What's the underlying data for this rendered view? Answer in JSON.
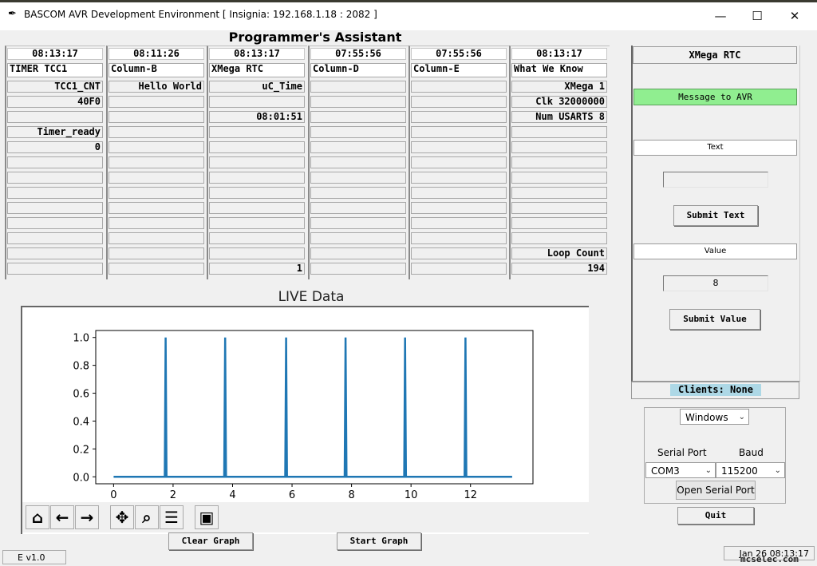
{
  "window": {
    "title": "BASCOM AVR Development Environment  [ Insignia: 192.168.1.18 : 2082 ]",
    "minimize": "—",
    "maximize": "☐",
    "close": "✕"
  },
  "assistant_title": "Programmer's Assistant",
  "columns": [
    {
      "time": "08:13:17",
      "header": "TIMER TCC1",
      "cells": [
        [
          "TCC1_CNT",
          "r"
        ],
        [
          "40F0",
          "r"
        ],
        [
          "",
          ""
        ],
        [
          "Timer_ready",
          "r"
        ],
        [
          "0",
          "r"
        ],
        [
          "",
          ""
        ],
        [
          "",
          ""
        ],
        [
          "",
          ""
        ],
        [
          "",
          ""
        ],
        [
          "",
          ""
        ],
        [
          "",
          ""
        ],
        [
          "",
          ""
        ],
        [
          "",
          ""
        ]
      ]
    },
    {
      "time": "08:11:26",
      "header": "Column-B",
      "cells": [
        [
          "Hello World",
          "r"
        ],
        [
          "",
          ""
        ],
        [
          "",
          ""
        ],
        [
          "",
          ""
        ],
        [
          "",
          ""
        ],
        [
          "",
          ""
        ],
        [
          "",
          ""
        ],
        [
          "",
          ""
        ],
        [
          "",
          ""
        ],
        [
          "",
          ""
        ],
        [
          "",
          ""
        ],
        [
          "",
          ""
        ],
        [
          "",
          ""
        ]
      ]
    },
    {
      "time": "08:13:17",
      "header": "XMega RTC",
      "cells": [
        [
          "uC_Time",
          "r"
        ],
        [
          "",
          ""
        ],
        [
          "08:01:51",
          "r"
        ],
        [
          "",
          ""
        ],
        [
          "",
          ""
        ],
        [
          "",
          ""
        ],
        [
          "",
          ""
        ],
        [
          "",
          ""
        ],
        [
          "",
          ""
        ],
        [
          "",
          ""
        ],
        [
          "",
          ""
        ],
        [
          "",
          ""
        ],
        [
          "1",
          "r"
        ]
      ]
    },
    {
      "time": "07:55:56",
      "header": "Column-D",
      "cells": [
        [
          "",
          ""
        ],
        [
          "",
          ""
        ],
        [
          "",
          ""
        ],
        [
          "",
          ""
        ],
        [
          "",
          ""
        ],
        [
          "",
          ""
        ],
        [
          "",
          ""
        ],
        [
          "",
          ""
        ],
        [
          "",
          ""
        ],
        [
          "",
          ""
        ],
        [
          "",
          ""
        ],
        [
          "",
          ""
        ],
        [
          "",
          ""
        ]
      ]
    },
    {
      "time": "07:55:56",
      "header": "Column-E",
      "cells": [
        [
          "",
          ""
        ],
        [
          "",
          ""
        ],
        [
          "",
          ""
        ],
        [
          "",
          ""
        ],
        [
          "",
          ""
        ],
        [
          "",
          ""
        ],
        [
          "",
          ""
        ],
        [
          "",
          ""
        ],
        [
          "",
          ""
        ],
        [
          "",
          ""
        ],
        [
          "",
          ""
        ],
        [
          "",
          ""
        ],
        [
          "",
          ""
        ]
      ]
    },
    {
      "time": "08:13:17",
      "header": "What We Know",
      "cells": [
        [
          "XMega    1",
          "r"
        ],
        [
          "Clk 32000000",
          "r"
        ],
        [
          "Num USARTS  8",
          "r"
        ],
        [
          "",
          ""
        ],
        [
          "",
          ""
        ],
        [
          "",
          ""
        ],
        [
          "",
          ""
        ],
        [
          "",
          ""
        ],
        [
          "",
          ""
        ],
        [
          "",
          ""
        ],
        [
          "",
          ""
        ],
        [
          "Loop Count",
          "r"
        ],
        [
          "194",
          "r"
        ]
      ]
    }
  ],
  "rtc_panel": {
    "title": "XMega RTC",
    "message_label": "Message to AVR",
    "text_label": "Text",
    "text_value": "",
    "submit_text": "Submit Text",
    "value_label": "Value",
    "value_value": "8",
    "submit_value": "Submit Value",
    "clients": "Clients: None"
  },
  "serial": {
    "platform": "Windows",
    "port_label": "Serial Port",
    "baud_label": "Baud",
    "port": "COM3",
    "baud": "115200",
    "open_button": "Open Serial Port",
    "quit_button": "Quit"
  },
  "graph": {
    "title": "LIVE Data",
    "clear_button": "Clear Graph",
    "start_button": "Start Graph"
  },
  "toolbar_icons": [
    "home-icon",
    "back-arrow-icon",
    "forward-arrow-icon",
    "pan-icon",
    "zoom-icon",
    "configure-subplots-icon",
    "save-icon"
  ],
  "chart_data": {
    "type": "line",
    "title": "",
    "xlabel": "",
    "ylabel": "",
    "xlim": [
      -0.6,
      14.1
    ],
    "ylim": [
      -0.05,
      1.05
    ],
    "xticks": [
      0,
      2,
      4,
      6,
      8,
      10,
      12
    ],
    "yticks": [
      0.0,
      0.2,
      0.4,
      0.6,
      0.8,
      1.0
    ],
    "series": [
      {
        "color": "#1f77b4",
        "points": [
          [
            0,
            0
          ],
          [
            1.72,
            0
          ],
          [
            1.75,
            1
          ],
          [
            1.78,
            0
          ],
          [
            3.72,
            0
          ],
          [
            3.75,
            1
          ],
          [
            3.78,
            0
          ],
          [
            5.77,
            0
          ],
          [
            5.8,
            1
          ],
          [
            5.83,
            0
          ],
          [
            7.77,
            0
          ],
          [
            7.8,
            1
          ],
          [
            7.83,
            0
          ],
          [
            9.77,
            0
          ],
          [
            9.8,
            1
          ],
          [
            9.83,
            0
          ],
          [
            11.8,
            0
          ],
          [
            11.83,
            1
          ],
          [
            11.86,
            0
          ],
          [
            13.4,
            0
          ]
        ]
      }
    ]
  },
  "status": {
    "version": "E v1.0",
    "datetime": "Jan 26 08:13:17",
    "watermark": "mcselec.com"
  }
}
